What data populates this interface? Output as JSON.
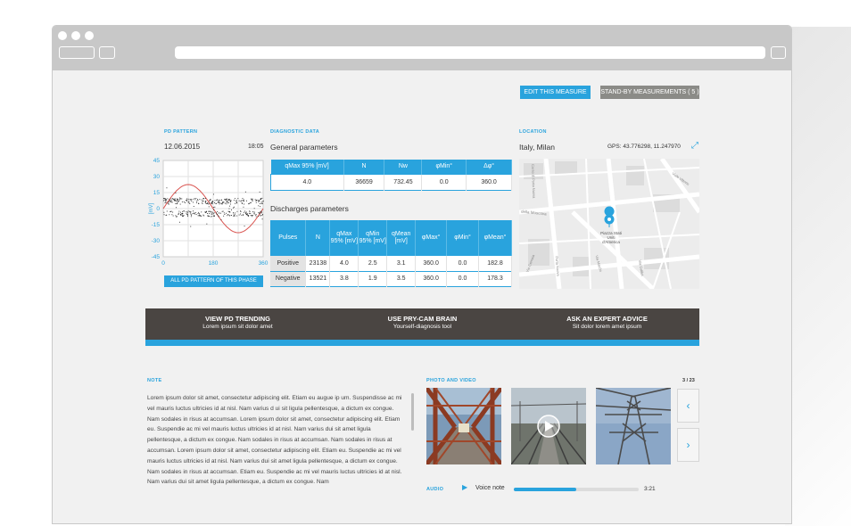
{
  "toolbar": {
    "edit_label": "EDIT THIS MEASURE",
    "standby_label": "STAND-BY MEASUREMENTS ( 5 )"
  },
  "pd_pattern": {
    "section": "PD PATTERN",
    "date": "12.06.2015",
    "time": "18:05",
    "ylabel": "[mV]",
    "yticks": [
      "45",
      "30",
      "15",
      "0",
      "-15",
      "-30",
      "-45"
    ],
    "xticks": [
      "0",
      "180",
      "360"
    ],
    "button": "ALL PD PATTERN OF THIS PHASE",
    "colors": {
      "axis": "#29a3dd",
      "sine": "#d9534f",
      "points": "#222222"
    }
  },
  "diagnostic": {
    "section": "DIAGNOSTIC DATA",
    "general_title": "General parameters",
    "general_headers": [
      "qMax 95% [mV]",
      "N",
      "Nw",
      "φMin°",
      "Δφ°"
    ],
    "general_values": [
      "4.0",
      "36659",
      "732.45",
      "0.0",
      "360.0"
    ],
    "discharges_title": "Discharges parameters",
    "discharges_headers": [
      "Pulses",
      "N",
      "qMax 95% [mV]",
      "qMin 95% [mV]",
      "qMean [mV]",
      "φMax°",
      "φMin°",
      "φMean°"
    ],
    "discharges_rows": [
      [
        "Positive",
        "23138",
        "4.0",
        "2.5",
        "3.1",
        "360.0",
        "0.0",
        "182.8"
      ],
      [
        "Negative",
        "13521",
        "3.8",
        "1.9",
        "3.5",
        "360.0",
        "0.0",
        "178.3"
      ]
    ]
  },
  "location": {
    "section": "LOCATION",
    "place": "Italy, Milan",
    "gps": "GPS: 43.776298, 11.247970",
    "map_labels": {
      "pin": "Piazza Stati Uniti d'America",
      "street1": "Corso di Porta Nuova",
      "street2": "Viale Vittorio",
      "street3": "della Moscova",
      "street4": "Via Marchi",
      "street5": "Via Cernaia",
      "street6": "Porta Nuova",
      "street7": "Via Galilei"
    }
  },
  "banner": [
    {
      "title": "VIEW PD TRENDING",
      "subtitle": "Lorem ipsum sit dolor amet"
    },
    {
      "title": "USE PRY-CAM BRAIN",
      "subtitle": "Yourself-diagnosis tool"
    },
    {
      "title": "ASK AN EXPERT ADVICE",
      "subtitle": "Sit dolor lorem amet ipsum"
    }
  ],
  "note": {
    "section": "NOTE",
    "text": "Lorem ipsum dolor sit amet, consectetur adipiscing elit. Etiam eu augue ip um. Suspendisse ac mi vel mauris luctus ultricies id at nisl.  Nam varius d ui sit  ligula pellentesque, a dictum ex congue. Nam sodales in risus at accumsan. Lorem ipsum dolor sit amet, consectetur adipiscing elit. Etiam eu. Suspendie ac mi vel mauris luctus ultricies id at nisl. Nam varius dui sit amet ligula pellentesque, a dictum ex congue. Nam sodales in risus at accumsan. Nam sodales in risus at accumsan. Lorem ipsum dolor sit amet, consectetur adipiscing elit. Etiam eu. Suspendie ac mi vel mauris luctus ultricies id at nisl. Nam varius dui sit amet ligula pellentesque, a dictum ex congue. Nam sodales in risus at accumsan.  Etiam eu. Suspendie ac mi vel mauris luctus ultricies id at nisl. Nam varius dui sit amet ligula pellentesque, a dictum ex congue. Nam"
  },
  "media": {
    "section": "PHOTO AND VIDEO",
    "counter": "3 / 23",
    "audio_section": "AUDIO",
    "audio_label": "Voice note",
    "audio_time": "3:21",
    "audio_progress": 0.5
  }
}
